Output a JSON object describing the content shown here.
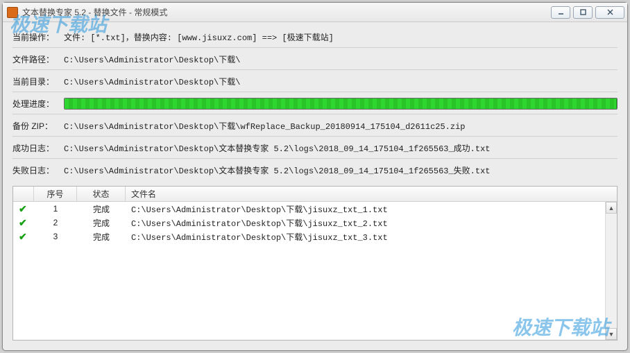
{
  "window": {
    "title": "文本替换专家 5.2 - 替换文件 - 常规模式"
  },
  "info": {
    "current_op_label": "当前操作：",
    "current_op_value": "文件: [*.txt]，替换内容: [www.jisuxz.com] ==> [极速下载站]",
    "file_path_label": "文件路径：",
    "file_path_value": "C:\\Users\\Administrator\\Desktop\\下载\\",
    "current_dir_label": "当前目录：",
    "current_dir_value": "C:\\Users\\Administrator\\Desktop\\下载\\",
    "progress_label": "处理进度：",
    "backup_zip_label": "备份 ZIP：",
    "backup_zip_value": "C:\\Users\\Administrator\\Desktop\\下载\\wfReplace_Backup_20180914_175104_d2611c25.zip",
    "success_log_label": "成功日志：",
    "success_log_value": "C:\\Users\\Administrator\\Desktop\\文本替换专家 5.2\\logs\\2018_09_14_175104_1f265563_成功.txt",
    "fail_log_label": "失败日志：",
    "fail_log_value": "C:\\Users\\Administrator\\Desktop\\文本替换专家 5.2\\logs\\2018_09_14_175104_1f265563_失败.txt"
  },
  "table": {
    "headers": {
      "index": "序号",
      "status": "状态",
      "file": "文件名"
    },
    "rows": [
      {
        "index": "1",
        "status": "完成",
        "file": "C:\\Users\\Administrator\\Desktop\\下载\\jisuxz_txt_1.txt"
      },
      {
        "index": "2",
        "status": "完成",
        "file": "C:\\Users\\Administrator\\Desktop\\下载\\jisuxz_txt_2.txt"
      },
      {
        "index": "3",
        "status": "完成",
        "file": "C:\\Users\\Administrator\\Desktop\\下载\\jisuxz_txt_3.txt"
      }
    ]
  },
  "watermark": "极速下载站"
}
